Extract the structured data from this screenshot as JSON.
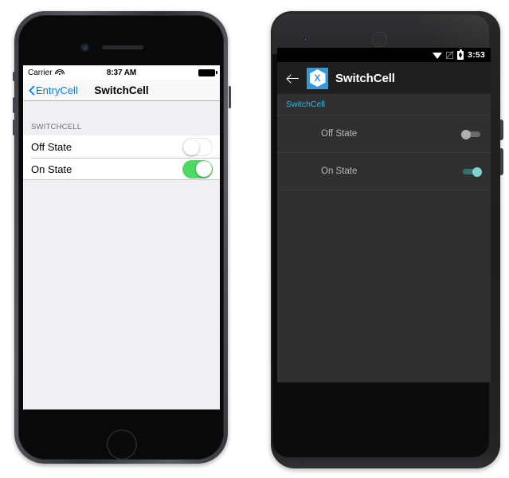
{
  "ios": {
    "status": {
      "carrier": "Carrier",
      "wifi_icon": "wifi-icon",
      "time": "8:37 AM",
      "battery_icon": "battery-full-icon"
    },
    "nav": {
      "back_label": "EntryCell",
      "back_icon": "chevron-left-icon",
      "title": "SwitchCell"
    },
    "section_header": "SWITCHCELL",
    "cells": [
      {
        "label": "Off State",
        "state": "off"
      },
      {
        "label": "On State",
        "state": "on"
      }
    ],
    "colors": {
      "tint": "#007aff",
      "switch_on": "#4cd964",
      "table_bg": "#efeff4",
      "separator": "#c8c7cc",
      "section_text": "#6d6d72"
    }
  },
  "android": {
    "status": {
      "wifi_icon": "wifi-icon",
      "sim_icon": "no-signal-icon",
      "battery_icon": "battery-charging-icon",
      "time": "3:53"
    },
    "action_bar": {
      "back_icon": "arrow-left-icon",
      "app_logo": "xamarin-logo-icon",
      "logo_glyph": "X",
      "title": "SwitchCell"
    },
    "section_header": "SwitchCell",
    "rows": [
      {
        "label": "Off State",
        "state": "off"
      },
      {
        "label": "On State",
        "state": "on"
      }
    ],
    "navbar": [
      {
        "name": "back",
        "icon": "triangle-back-icon"
      },
      {
        "name": "home",
        "icon": "circle-home-icon"
      },
      {
        "name": "recents",
        "icon": "square-recents-icon"
      }
    ],
    "colors": {
      "accent": "#33b5e5",
      "list_bg": "#303030",
      "action_bar_bg": "#1f1f1f",
      "logo_bg": "#3498db",
      "switch_on_thumb": "#7fd4cf",
      "switch_off_thumb": "#b0b0b0",
      "row_text": "#b6b6b6"
    }
  }
}
